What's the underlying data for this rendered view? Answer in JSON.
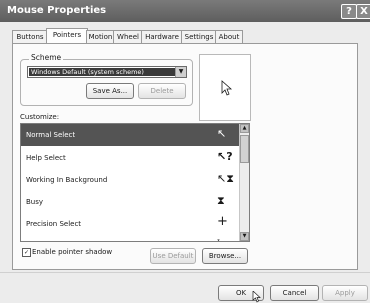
{
  "title": "Mouse Properties",
  "title_buttons": {
    "help": "?",
    "close": "X"
  },
  "tabs": [
    "Buttons",
    "Pointers",
    "Motion",
    "Wheel",
    "Hardware",
    "Settings",
    "About"
  ],
  "active_tab": "Pointers",
  "scheme": {
    "label": "Scheme",
    "selected": "Windows Default (system scheme)",
    "save_as": "Save As...",
    "delete": "Delete"
  },
  "customize": {
    "label": "Customize:",
    "items": [
      {
        "label": "Normal Select",
        "icon": "arrow-cursor-icon",
        "glyph": "↖",
        "selected": true
      },
      {
        "label": "Help Select",
        "icon": "help-cursor-icon",
        "glyph": "↖?"
      },
      {
        "label": "Working In Background",
        "icon": "busy-arrow-cursor-icon",
        "glyph": "↖⧗"
      },
      {
        "label": "Busy",
        "icon": "hourglass-cursor-icon",
        "glyph": "⧗"
      },
      {
        "label": "Precision Select",
        "icon": "crosshair-cursor-icon",
        "glyph": "+"
      },
      {
        "label": "",
        "icon": "text-cursor-icon",
        "glyph": "ɪ"
      }
    ]
  },
  "shadow": {
    "label": "Enable pointer shadow",
    "checked": true
  },
  "use_default": "Use Default",
  "browse": "Browse...",
  "footer": {
    "ok": "OK",
    "cancel": "Cancel",
    "apply": "Apply"
  }
}
